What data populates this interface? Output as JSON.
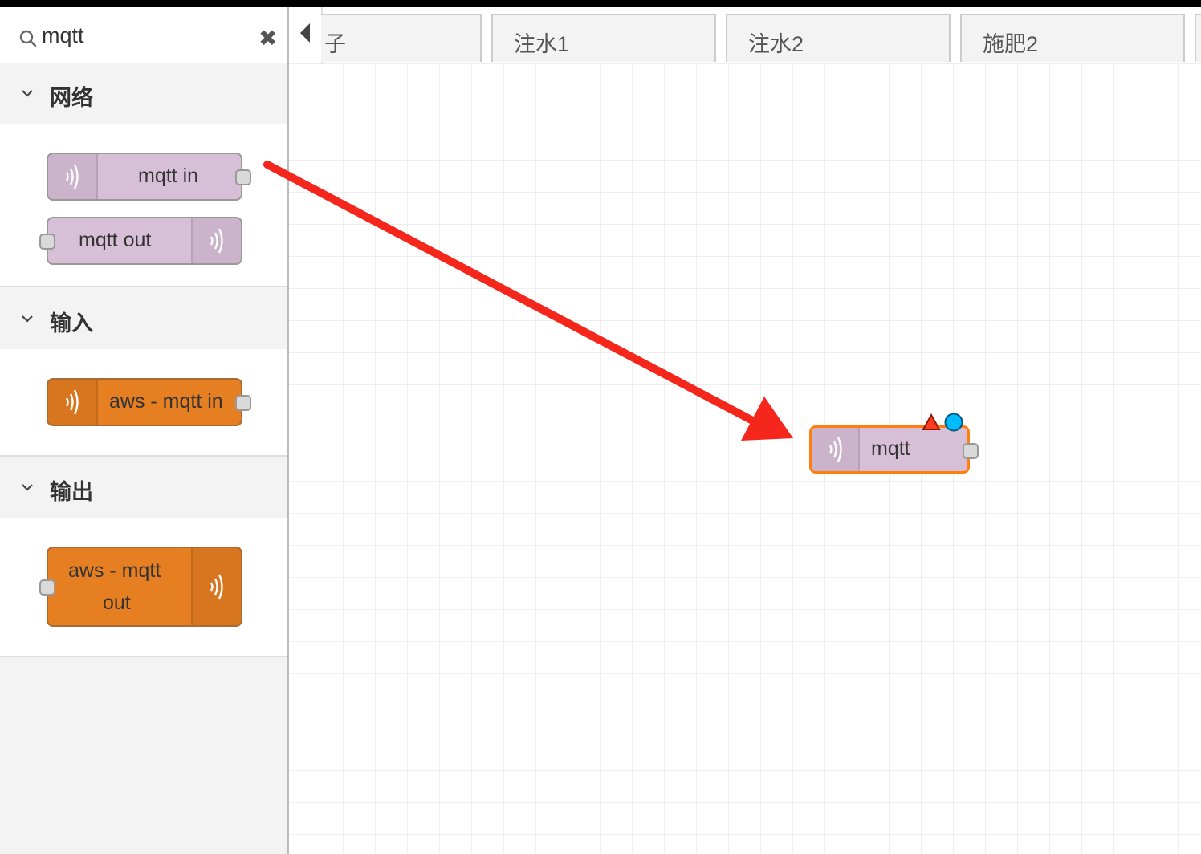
{
  "palette": {
    "search": {
      "value": "mqtt",
      "clear_glyph": "✖"
    },
    "categories": [
      {
        "label": "网络",
        "nodes": [
          {
            "label": "mqtt in"
          },
          {
            "label": "mqtt out"
          }
        ]
      },
      {
        "label": "输入",
        "nodes": [
          {
            "label": "aws - mqtt in"
          }
        ]
      },
      {
        "label": "输出",
        "nodes": [
          {
            "label_line1": "aws - mqtt",
            "label_line2": "out"
          }
        ]
      }
    ]
  },
  "tabs": [
    {
      "label": "子"
    },
    {
      "label": "注水1"
    },
    {
      "label": "注水2"
    },
    {
      "label": "施肥2"
    }
  ],
  "workspace": {
    "node": {
      "label": "mqtt"
    }
  },
  "colors": {
    "mqtt_node": "#d8bfd8",
    "aws_node": "#e67e22",
    "selected_border": "#ff7f0e",
    "annotation_arrow": "#f5271d",
    "changed_badge": "#00bcff",
    "error_badge": "#ff0000"
  },
  "icons": {
    "search": "search-icon",
    "chevron": "chevron-down-icon",
    "node": "wifi-signal-icon",
    "tab_scroll": "caret-left-icon"
  }
}
